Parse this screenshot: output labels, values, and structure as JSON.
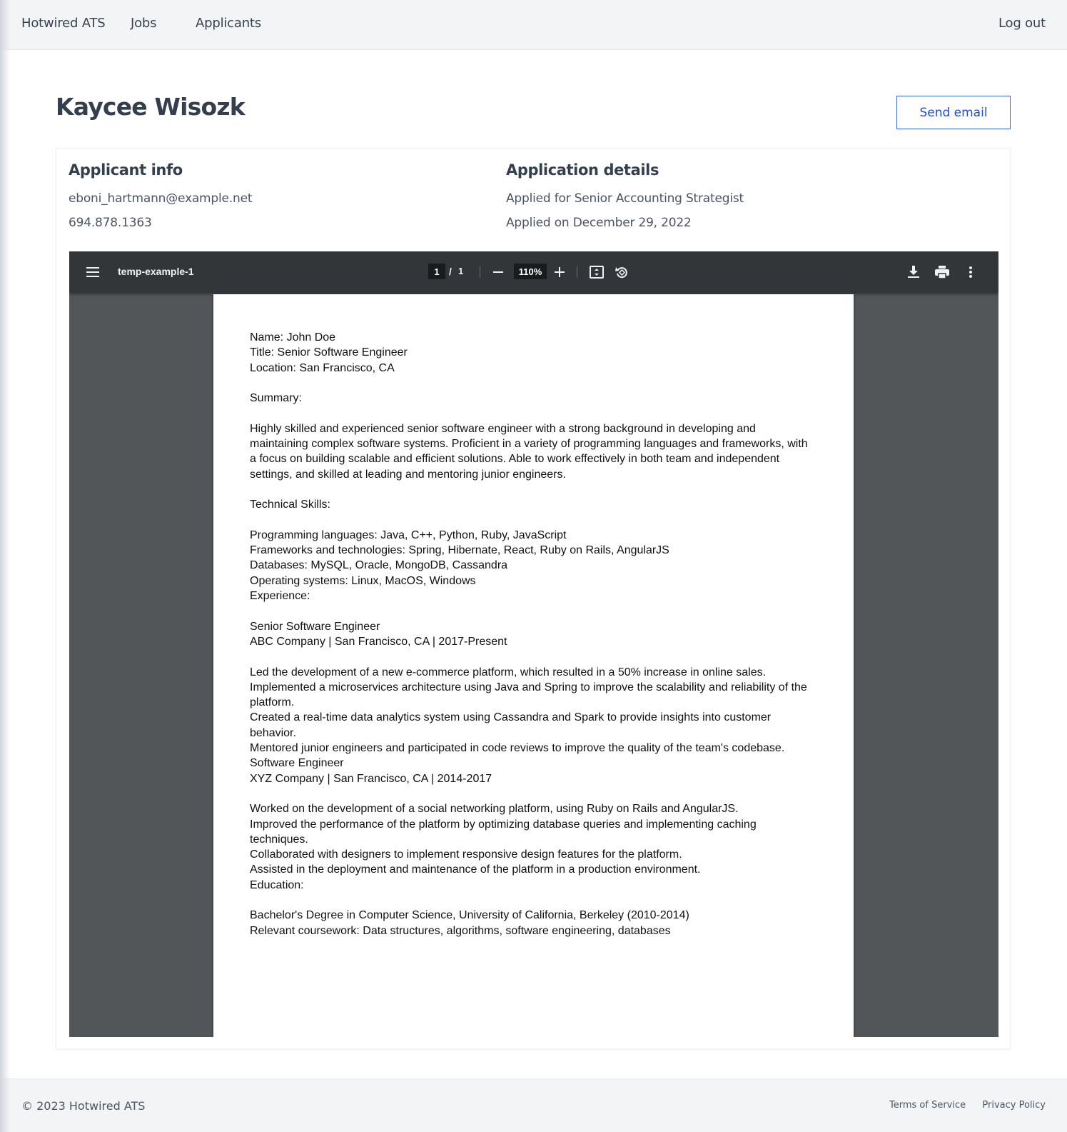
{
  "nav": {
    "brand": "Hotwired ATS",
    "jobs": "Jobs",
    "applicants": "Applicants",
    "logout": "Log out"
  },
  "applicant": {
    "name": "Kaycee Wisozk",
    "send_email_label": "Send email",
    "info_heading": "Applicant info",
    "email": "eboni_hartmann@example.net",
    "phone": "694.878.1363",
    "details_heading": "Application details",
    "applied_for": "Applied for Senior Accounting Strategist",
    "applied_on": "Applied on December 29, 2022"
  },
  "pdf_viewer": {
    "title": "temp-example-1",
    "current_page": "1",
    "page_separator": "/",
    "total_pages": "1",
    "zoom": "110%",
    "icons": [
      "menu-icon",
      "zoom-out-icon",
      "zoom-in-icon",
      "fit-page-icon",
      "rotate-icon",
      "download-icon",
      "print-icon",
      "more-vert-icon"
    ],
    "content": [
      "Name: John Doe",
      "Title: Senior Software Engineer",
      "Location: San Francisco, CA",
      "",
      "Summary:",
      "",
      "Highly skilled and experienced senior software engineer with a strong background in developing and",
      "maintaining complex software systems. Proficient in a variety of programming languages and frameworks, with",
      "a focus on building scalable and efficient solutions. Able to work effectively in both team and independent",
      "settings, and skilled at leading and mentoring junior engineers.",
      "",
      "Technical Skills:",
      "",
      "Programming languages: Java, C++, Python, Ruby, JavaScript",
      "Frameworks and technologies: Spring, Hibernate, React, Ruby on Rails, AngularJS",
      "Databases: MySQL, Oracle, MongoDB, Cassandra",
      "Operating systems: Linux, MacOS, Windows",
      "Experience:",
      "",
      "Senior Software Engineer",
      "ABC Company | San Francisco, CA | 2017-Present",
      "",
      "Led the development of a new e-commerce platform, which resulted in a 50% increase in online sales.",
      "Implemented a microservices architecture using Java and Spring to improve the scalability and reliability of the",
      "platform.",
      "Created a real-time data analytics system using Cassandra and Spark to provide insights into customer",
      "behavior.",
      "Mentored junior engineers and participated in code reviews to improve the quality of the team's codebase.",
      "Software Engineer",
      "XYZ Company | San Francisco, CA | 2014-2017",
      "",
      "Worked on the development of a social networking platform, using Ruby on Rails and AngularJS.",
      "Improved the performance of the platform by optimizing database queries and implementing caching",
      "techniques.",
      "Collaborated with designers to implement responsive design features for the platform.",
      "Assisted in the deployment and maintenance of the platform in a production environment.",
      "Education:",
      "",
      "Bachelor's Degree in Computer Science, University of California, Berkeley (2010-2014)",
      "Relevant coursework: Data structures, algorithms, software engineering, databases"
    ]
  },
  "footer": {
    "copyright": "© 2023 Hotwired ATS",
    "terms": "Terms of Service",
    "privacy": "Privacy Policy"
  }
}
